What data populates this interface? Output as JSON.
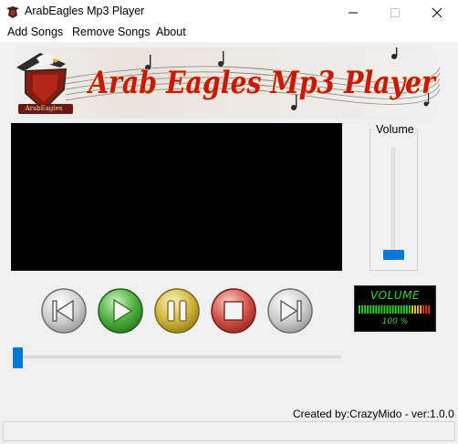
{
  "window": {
    "title": "ArabEagles Mp3 Player",
    "icons": {
      "app": "eagle-logo-icon",
      "minimize": "minimize-icon",
      "maximize": "maximize-icon",
      "close": "close-icon"
    }
  },
  "menu": {
    "items": [
      {
        "label": "Add Songs"
      },
      {
        "label": "Remove Songs"
      },
      {
        "label": "About"
      }
    ]
  },
  "banner": {
    "title": "Arab Eagles Mp3 Player",
    "logo_text": "ArabEagles",
    "colors": {
      "title_fill": "#c41a10",
      "title_outline": "#f3d9a0"
    }
  },
  "volume": {
    "label": "Volume",
    "level": 0.05
  },
  "controls": [
    {
      "name": "previous",
      "icon": "skip-previous-icon",
      "color": "gray"
    },
    {
      "name": "play",
      "icon": "play-icon",
      "color": "green"
    },
    {
      "name": "pause",
      "icon": "pause-icon",
      "color": "yellow"
    },
    {
      "name": "stop",
      "icon": "stop-icon",
      "color": "red"
    },
    {
      "name": "next",
      "icon": "skip-next-icon",
      "color": "gray"
    }
  ],
  "vu_meter": {
    "label": "VOLUME",
    "percent_text": "100 %",
    "level": 1.0
  },
  "seek": {
    "position": 0.0
  },
  "footer": {
    "credit": "Created by:CrazyMido - ver:1.0.0"
  },
  "colors": {
    "accent": "#0078d7",
    "background": "#f0f0f0",
    "video_bg": "#000000",
    "vu_green": "#3cd03c"
  }
}
